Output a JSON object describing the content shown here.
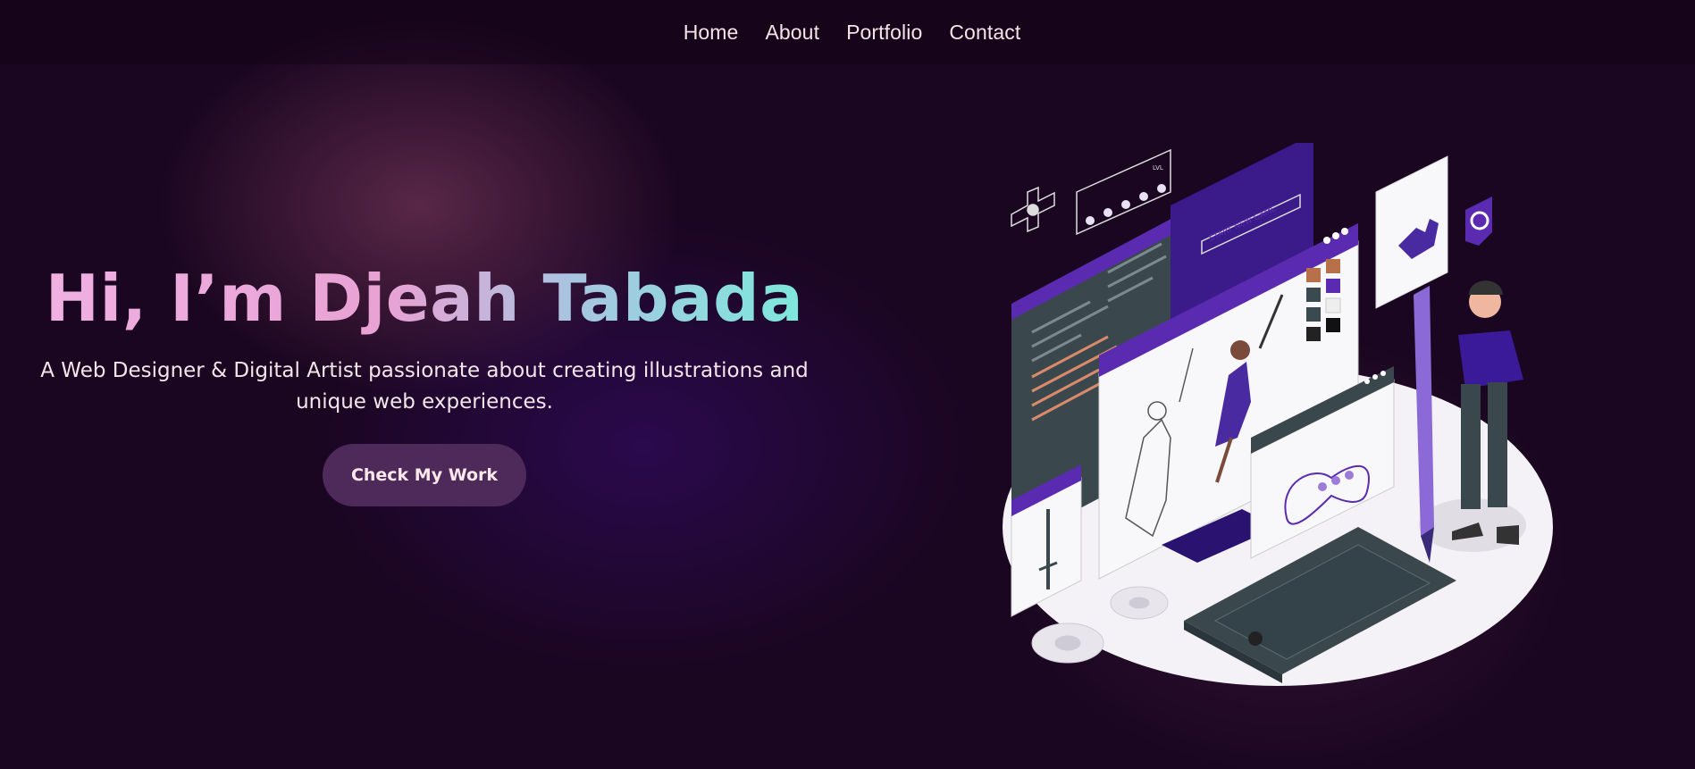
{
  "nav": {
    "items": [
      "Home",
      "About",
      "Portfolio",
      "Contact"
    ]
  },
  "hero": {
    "title": "Hi, I’m Djeah Tabada",
    "subtitle": "A Web Designer & Digital Artist passionate about creating illustrations and unique web experiences.",
    "cta_label": "Check My Work"
  },
  "illustration": {
    "label_start_game": "START NEW GAME",
    "label_lvl": "LVL"
  },
  "colors": {
    "background": "#1a0620",
    "accent_purple": "#5a2bb0",
    "button": "#4e2a5a",
    "title_gradient_start": "#f0b0e2",
    "title_gradient_end": "#7ee8dc"
  }
}
